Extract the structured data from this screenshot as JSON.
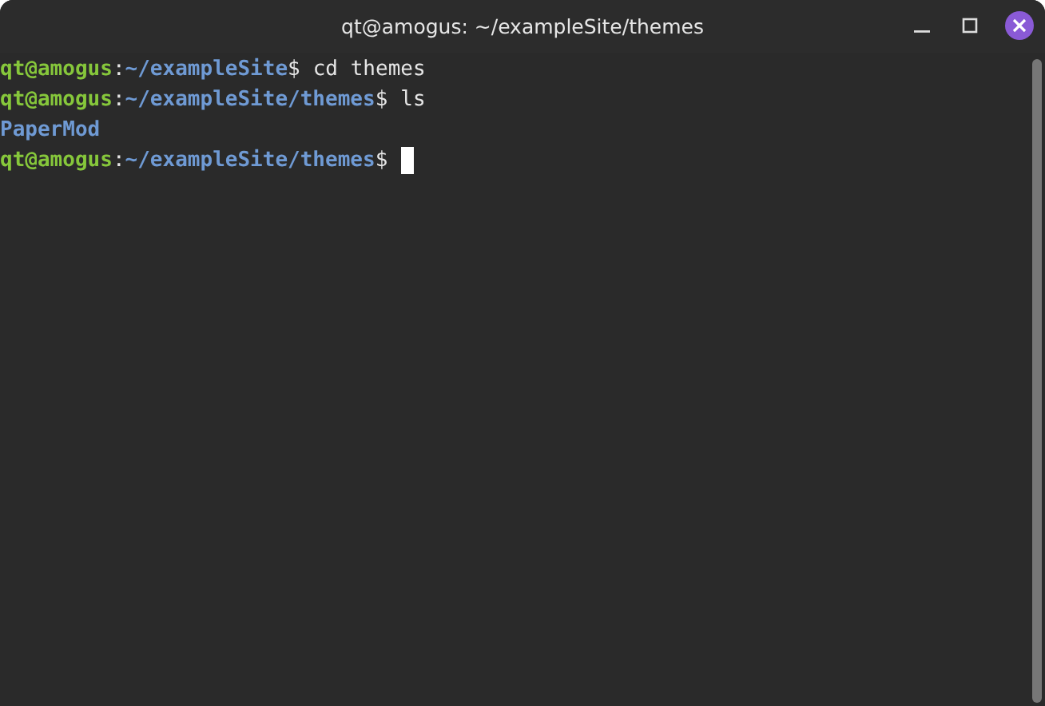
{
  "window": {
    "title": "qt@amogus: ~/exampleSite/themes"
  },
  "lines": [
    {
      "kind": "prompt",
      "user": "qt@amogus",
      "separator": ":",
      "path": "~/exampleSite",
      "symbol": "$",
      "command": "cd themes",
      "cursor": false
    },
    {
      "kind": "prompt",
      "user": "qt@amogus",
      "separator": ":",
      "path": "~/exampleSite/themes",
      "symbol": "$",
      "command": "ls",
      "cursor": false
    },
    {
      "kind": "directory",
      "text": "PaperMod"
    },
    {
      "kind": "prompt",
      "user": "qt@amogus",
      "separator": ":",
      "path": "~/exampleSite/themes",
      "symbol": "$",
      "cursor": true
    }
  ]
}
